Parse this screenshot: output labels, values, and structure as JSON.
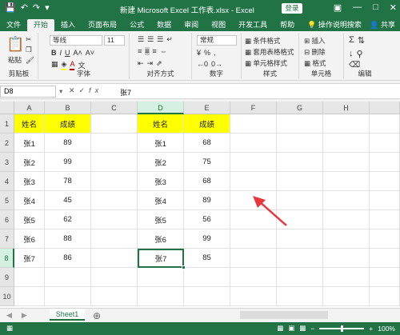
{
  "titlebar": {
    "title": "新建 Microsoft Excel 工作表.xlsx  -  Excel",
    "login": "登录"
  },
  "tabs": [
    "文件",
    "开始",
    "插入",
    "页面布局",
    "公式",
    "数据",
    "审阅",
    "视图",
    "开发工具",
    "帮助",
    "操作说明搜索"
  ],
  "share": "共享",
  "ribbon": {
    "clipboard": {
      "label": "剪贴板",
      "paste": "粘贴"
    },
    "font": {
      "label": "字体",
      "name": "等线",
      "size": "11"
    },
    "alignment": {
      "label": "对齐方式"
    },
    "number": {
      "label": "数字",
      "format": "常规"
    },
    "styles": {
      "label": "样式",
      "conditional": "条件格式",
      "table": "套用表格格式",
      "cell": "单元格样式"
    },
    "cells": {
      "label": "单元格",
      "insert": "插入",
      "delete": "删除",
      "format": "格式"
    },
    "editing": {
      "label": "编辑"
    }
  },
  "formula": {
    "namebox": "D8",
    "fx": "fx",
    "value": "张7"
  },
  "columns": [
    "A",
    "B",
    "C",
    "D",
    "E",
    "F",
    "G",
    "H"
  ],
  "rows": [
    "1",
    "2",
    "3",
    "4",
    "5",
    "6",
    "7",
    "8",
    "9",
    "10"
  ],
  "cells": {
    "A": [
      "姓名",
      "张1",
      "张2",
      "张3",
      "张4",
      "张5",
      "张6",
      "张7"
    ],
    "B": [
      "成绩",
      "89",
      "99",
      "78",
      "45",
      "62",
      "88",
      "86"
    ],
    "D": [
      "姓名",
      "张1",
      "张2",
      "张3",
      "张4",
      "张5",
      "张6",
      "张7"
    ],
    "E": [
      "成绩",
      "68",
      "75",
      "68",
      "89",
      "56",
      "99",
      "85"
    ]
  },
  "sheet": {
    "name": "Sheet1"
  },
  "status": {
    "zoom": "100%"
  },
  "colors": {
    "accent": "#217346",
    "highlight": "#ffff00",
    "arrow": "#e8383d"
  }
}
